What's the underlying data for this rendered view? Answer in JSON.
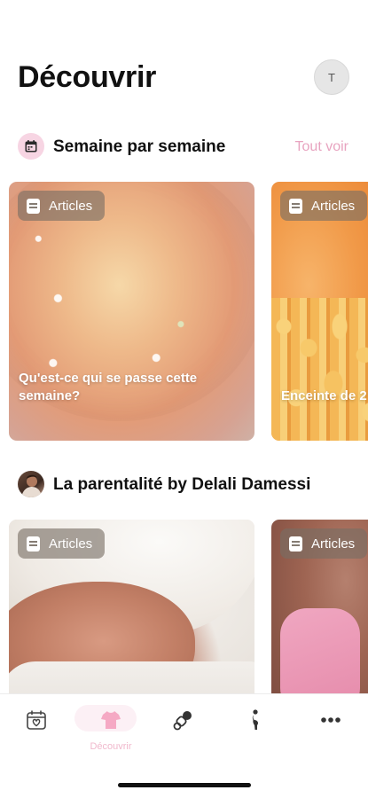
{
  "header": {
    "title": "Découvrir",
    "avatar_initial": "T"
  },
  "sections": [
    {
      "title": "Semaine par semaine",
      "see_all": "Tout voir",
      "icon": "calendar-icon",
      "cards": [
        {
          "badge": "Articles",
          "caption": "Qu'est-ce qui se passe cette semaine?"
        },
        {
          "badge": "Articles",
          "caption": "Enceinte de 2"
        }
      ]
    },
    {
      "title": "La parentalité by Delali Damessi",
      "icon": "author-avatar",
      "cards": [
        {
          "badge": "Articles"
        },
        {
          "badge": "Articles"
        }
      ]
    }
  ],
  "tabbar": {
    "tabs": [
      {
        "icon": "calendar-heart-icon",
        "label": ""
      },
      {
        "icon": "baby-clothes-icon",
        "label": "Découvrir",
        "active": true
      },
      {
        "icon": "pacifier-icon",
        "label": ""
      },
      {
        "icon": "pregnant-silhouette-icon",
        "label": ""
      },
      {
        "icon": "more-icon",
        "label": ""
      }
    ]
  },
  "colors": {
    "accent_pink": "#e8a4c0",
    "active_tab": "#f0b8cc"
  }
}
